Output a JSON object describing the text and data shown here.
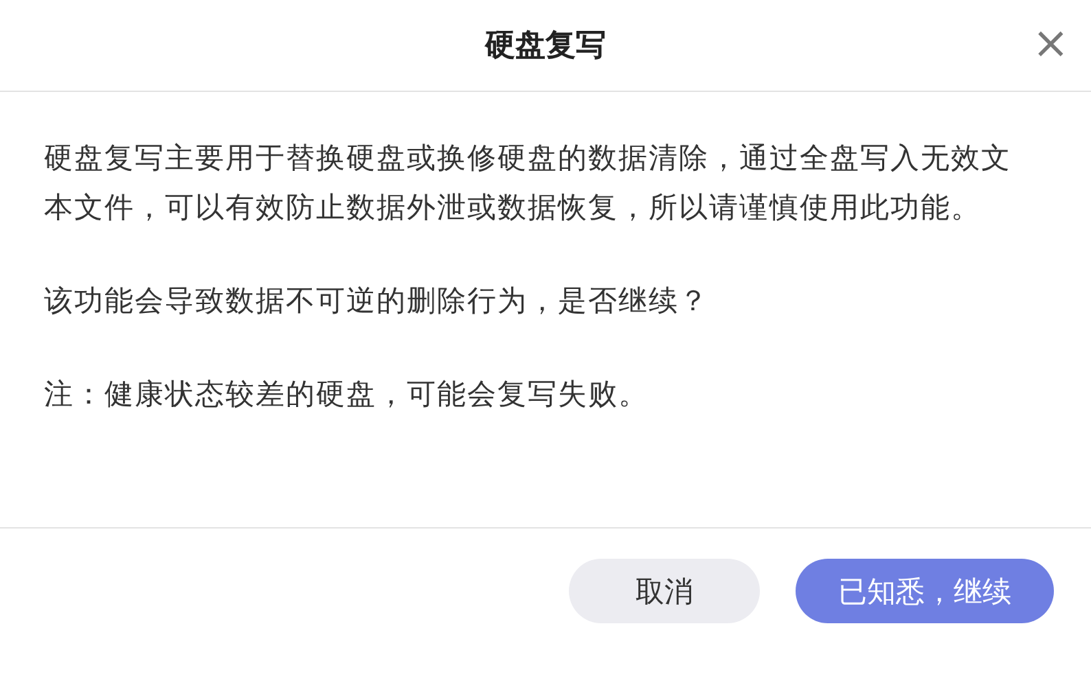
{
  "dialog": {
    "title": "硬盘复写",
    "close": "×",
    "paragraphs": [
      "硬盘复写主要用于替换硬盘或换修硬盘的数据清除，通过全盘写入无效文本文件，可以有效防止数据外泄或数据恢复，所以请谨慎使用此功能。",
      "该功能会导致数据不可逆的删除行为，是否继续？",
      "注：健康状态较差的硬盘，可能会复写失败。"
    ],
    "buttons": [
      {
        "label": "取消",
        "kind": "secondary"
      },
      {
        "label": "已知悉，继续",
        "kind": "primary"
      }
    ]
  }
}
